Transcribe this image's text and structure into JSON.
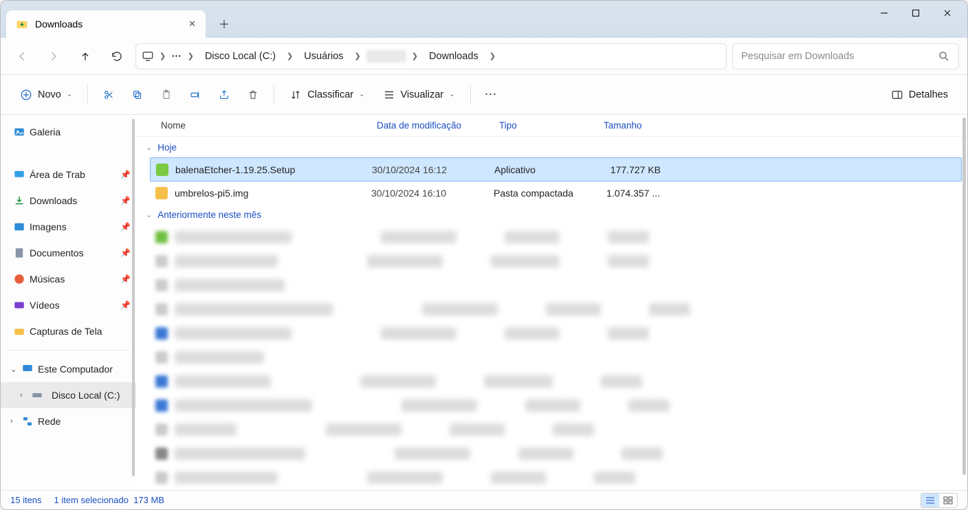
{
  "tab": {
    "title": "Downloads"
  },
  "breadcrumb": {
    "segments": [
      "Disco Local (C:)",
      "Usuários",
      "",
      "Downloads"
    ]
  },
  "search": {
    "placeholder": "Pesquisar em Downloads"
  },
  "toolbar": {
    "new_label": "Novo",
    "sort_label": "Classificar",
    "view_label": "Visualizar",
    "details_label": "Detalhes"
  },
  "sidebar": {
    "gallery": "Galeria",
    "desktop": "Área de Trab",
    "downloads": "Downloads",
    "images": "Imagens",
    "documents": "Documentos",
    "music": "Músicas",
    "videos": "Vídeos",
    "screenshots": "Capturas de Tela",
    "this_pc": "Este Computador",
    "drive_c": "Disco Local (C:)",
    "network": "Rede"
  },
  "columns": {
    "name": "Nome",
    "date": "Data de modificação",
    "type": "Tipo",
    "size": "Tamanho"
  },
  "groups": {
    "today": "Hoje",
    "earlier": "Anteriormente neste mês"
  },
  "files": [
    {
      "name": "balenaEtcher-1.19.25.Setup",
      "date": "30/10/2024 16:12",
      "type": "Aplicativo",
      "size": "177.727 KB",
      "selected": true,
      "icon_color": "#7ac943"
    },
    {
      "name": "umbrelos-pi5.img",
      "date": "30/10/2024 16:10",
      "type": "Pasta compactada",
      "size": "1.074.357 ...",
      "selected": false,
      "icon_color": "#f5c04a"
    }
  ],
  "status": {
    "count": "15 itens",
    "selected": "1 item selecionado",
    "size": "173 MB"
  }
}
